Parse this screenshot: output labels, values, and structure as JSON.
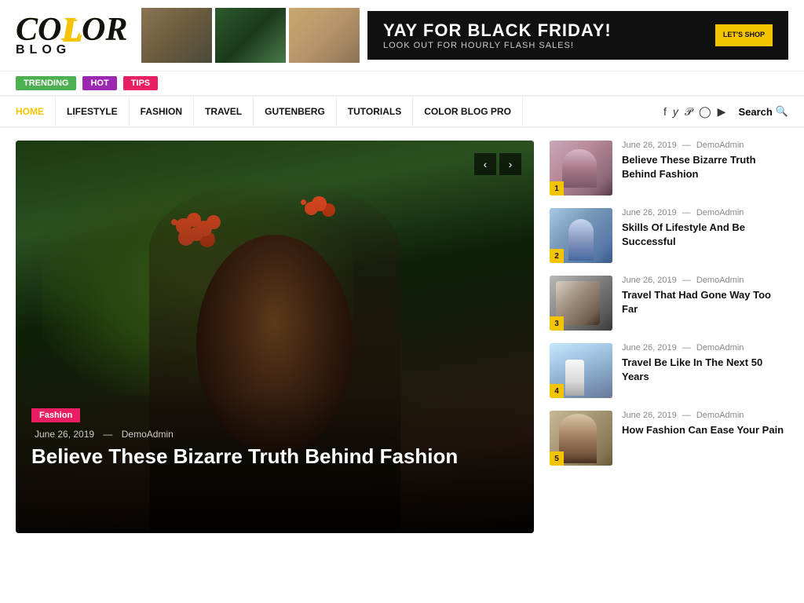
{
  "logo": {
    "color": "COLOR",
    "blog": "BLOG"
  },
  "banner": {
    "headline": "YAY FOR BLACK FRIDAY!",
    "subtext": "LOOK OUT FOR HOURLY FLASH SALES!",
    "btn": "LET'S SHOP"
  },
  "tags": [
    {
      "label": "TRENDING",
      "class": "tag-trending"
    },
    {
      "label": "HOT",
      "class": "tag-hot"
    },
    {
      "label": "TIPS",
      "class": "tag-tips"
    }
  ],
  "nav": {
    "links": [
      {
        "label": "HOME",
        "active": true
      },
      {
        "label": "LIFESTYLE",
        "active": false
      },
      {
        "label": "FASHION",
        "active": false
      },
      {
        "label": "TRAVEL",
        "active": false
      },
      {
        "label": "GUTENBERG",
        "active": false
      },
      {
        "label": "TUTORIALS",
        "active": false
      },
      {
        "label": "COLOR BLOG PRO",
        "active": false
      }
    ],
    "search_label": "Search"
  },
  "hero": {
    "category": "Fashion",
    "date": "June 26, 2019",
    "author": "DemoAdmin",
    "title": "Believe These Bizarre Truth Behind Fashion"
  },
  "sidebar": {
    "items": [
      {
        "num": "1",
        "date": "June 26, 2019",
        "author": "DemoAdmin",
        "title": "Believe These Bizarre Truth Behind Fashion"
      },
      {
        "num": "2",
        "date": "June 26, 2019",
        "author": "DemoAdmin",
        "title": "Skills Of Lifestyle And Be Successful"
      },
      {
        "num": "3",
        "date": "June 26, 2019",
        "author": "DemoAdmin",
        "title": "Travel That Had Gone Way Too Far"
      },
      {
        "num": "4",
        "date": "June 26, 2019",
        "author": "DemoAdmin",
        "title": "Travel Be Like In The Next 50 Years"
      },
      {
        "num": "5",
        "date": "June 26, 2019",
        "author": "DemoAdmin",
        "title": "How Fashion Can Ease Your Pain"
      }
    ]
  }
}
